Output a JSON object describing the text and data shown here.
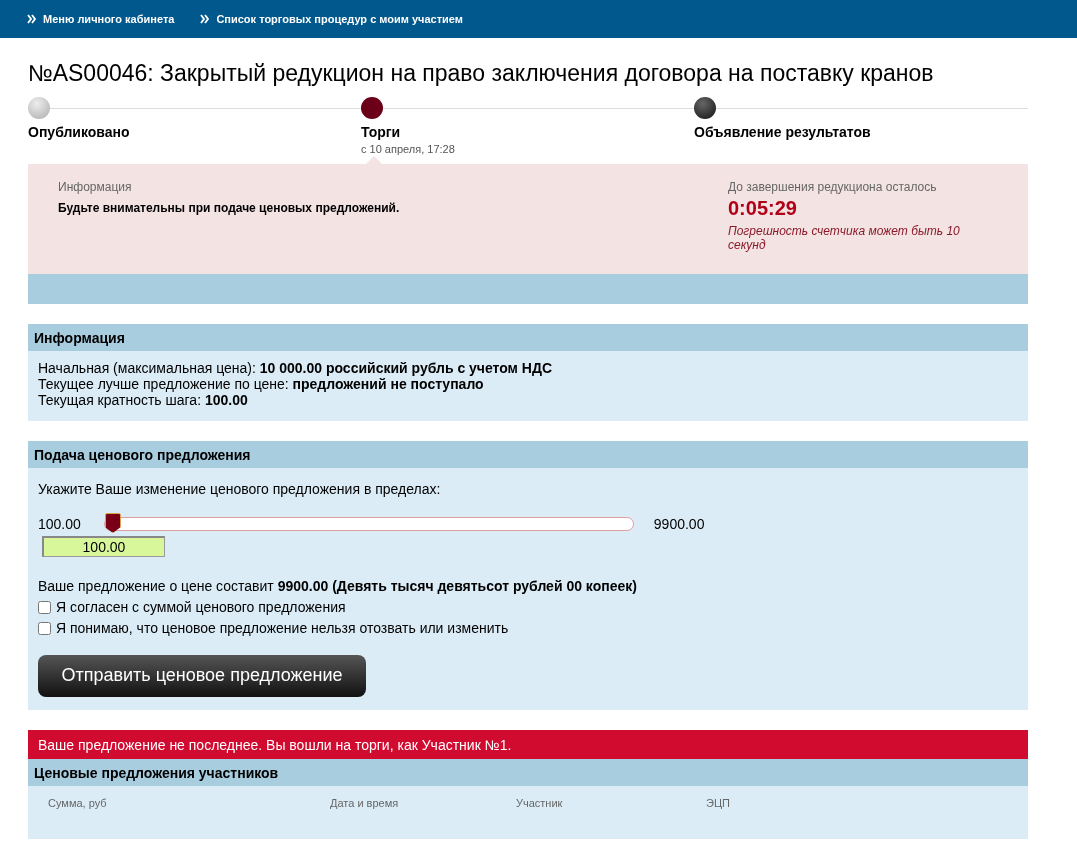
{
  "top_nav": [
    {
      "label": "Меню личного кабинета"
    },
    {
      "label": "Список торговых процедур с моим участием"
    }
  ],
  "title": "№AS00046: Закрытый редукцион на право заключения договора на поставку кранов",
  "stages": [
    {
      "label": "Опубликовано",
      "kind": "done"
    },
    {
      "label": "Торги",
      "date": "с 10 апреля, 17:28",
      "kind": "current"
    },
    {
      "label": "Объявление результатов",
      "kind": "pending"
    }
  ],
  "notice": {
    "caption": "Информация",
    "message": "Будьте внимательны при подаче ценовых предложений.",
    "timer_caption": "До завершения редукциона осталось",
    "timer": "0:05:29",
    "timer_note": "Погрешность счетчика может быть 10 секунд"
  },
  "info": {
    "header": "Информация",
    "lines": [
      "Начальная (максимальная цена): **10 000.00 российский рубль с учетом НДС**",
      "Текущее лучше предложение по цене: **предложений не поступало**",
      "Текущая кратность шага: **100.00**"
    ]
  },
  "bid": {
    "header": "Подача ценового предложения",
    "prompt": "Укажите Ваше изменение ценового предложения в пределах:",
    "min": "100.00",
    "max": "9900.00",
    "level": 0,
    "value": "100.00",
    "summary": "Ваше предложение о цене составит **9900.00 (Девять тысяч девятьсот рублей 00 копеек)**",
    "checkboxes": [
      {
        "label": "Я согласен с суммой ценового предложения",
        "checked": false
      },
      {
        "label": "Я понимаю, что ценовое предложение нельзя отозвать или изменить",
        "checked": false
      }
    ],
    "button": "Отправить ценовое предложение"
  },
  "alert": "Ваше предложение не последнее. Вы вошли на торги, как Участник №1.",
  "offers": {
    "header": "Ценовые предложения участников",
    "columns": [
      "Сумма, руб",
      "Дата и время",
      "Участник",
      "ЭЦП"
    ]
  }
}
